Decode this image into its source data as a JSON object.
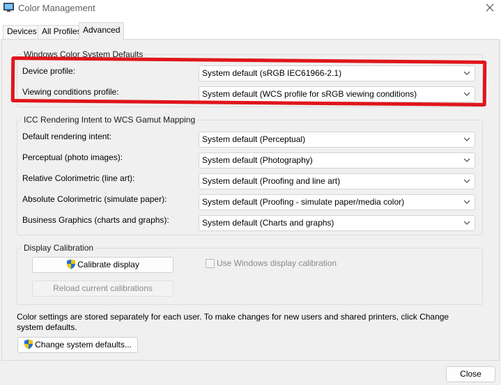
{
  "window": {
    "title": "Color Management",
    "icon": "monitor-icon",
    "close": "close-icon"
  },
  "tabs": [
    {
      "label": "Devices",
      "active": false
    },
    {
      "label": "All Profiles",
      "active": false
    },
    {
      "label": "Advanced",
      "active": true
    }
  ],
  "wcs_defaults": {
    "legend": "Windows Color System Defaults",
    "device_profile": {
      "label": "Device profile:",
      "value": "System default (sRGB IEC61966-2.1)"
    },
    "viewing_conditions": {
      "label": "Viewing conditions profile:",
      "value": "System default (WCS profile for sRGB viewing conditions)"
    }
  },
  "icc_mapping": {
    "legend": "ICC Rendering Intent to WCS Gamut Mapping",
    "rows": [
      {
        "label": "Default rendering intent:",
        "value": "System default (Perceptual)"
      },
      {
        "label": "Perceptual (photo images):",
        "value": "System default (Photography)"
      },
      {
        "label": "Relative Colorimetric (line art):",
        "value": "System default (Proofing and line art)"
      },
      {
        "label": "Absolute Colorimetric (simulate paper):",
        "value": "System default (Proofing - simulate paper/media color)"
      },
      {
        "label": "Business Graphics (charts and graphs):",
        "value": "System default (Charts and graphs)"
      }
    ]
  },
  "calibration": {
    "legend": "Display Calibration",
    "calibrate_button": "Calibrate display",
    "reload_button": "Reload current calibrations",
    "use_windows_calibration": {
      "label": "Use Windows display calibration",
      "checked": false,
      "enabled": false
    }
  },
  "footer": {
    "note": "Color settings are stored separately for each user. To make changes for new users and shared printers, click Change system defaults.",
    "change_defaults_button": "Change system defaults...",
    "close_button": "Close"
  },
  "colors": {
    "highlight": "#e0151b",
    "shield_blue": "#1f6fd1",
    "shield_yellow": "#f2c400"
  }
}
